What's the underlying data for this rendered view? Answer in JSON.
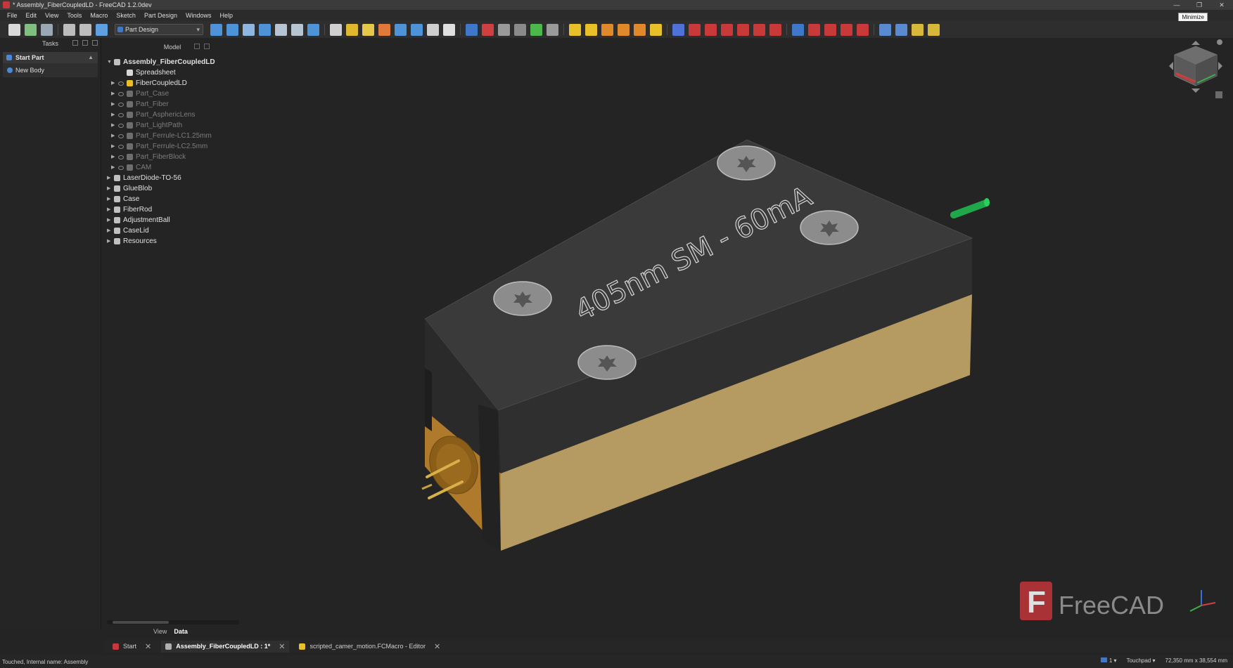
{
  "window": {
    "title": "* Assembly_FiberCoupledLD - FreeCAD 1.2.0dev",
    "minimize": "—",
    "restore": "❐",
    "close": "✕",
    "tooltip": "Minimize"
  },
  "menu": [
    "File",
    "Edit",
    "View",
    "Tools",
    "Macro",
    "Sketch",
    "Part Design",
    "Windows",
    "Help"
  ],
  "toolbar": {
    "workbench": "Part Design"
  },
  "tasks": {
    "header": "Tasks",
    "box_title": "Start Part",
    "items": [
      "New Body"
    ]
  },
  "model": {
    "header": "Model",
    "tree": [
      {
        "label": "Assembly_FiberCoupledLD",
        "level": 0
      },
      {
        "label": "Spreadsheet",
        "level": 1
      },
      {
        "label": "FiberCoupledLD",
        "level": 1
      },
      {
        "label": "Part_Case",
        "level": 1
      },
      {
        "label": "Part_Fiber",
        "level": 1
      },
      {
        "label": "Part_AsphericLens",
        "level": 1
      },
      {
        "label": "Part_LightPath",
        "level": 1
      },
      {
        "label": "Part_Ferrule-LC1.25mm",
        "level": 1
      },
      {
        "label": "Part_Ferrule-LC2.5mm",
        "level": 1
      },
      {
        "label": "Part_FiberBlock",
        "level": 1
      },
      {
        "label": "CAM",
        "level": 1
      },
      {
        "label": "LaserDiode-TO-56",
        "level": 0
      },
      {
        "label": "GlueBlob",
        "level": 0
      },
      {
        "label": "Case",
        "level": 0
      },
      {
        "label": "FiberRod",
        "level": 0
      },
      {
        "label": "AdjustmentBall",
        "level": 0
      },
      {
        "label": "CaseLid",
        "level": 0
      },
      {
        "label": "Resources",
        "level": 0
      }
    ],
    "tabs": [
      "View",
      "Data"
    ]
  },
  "viewport": {
    "engraving": "405nm SM - 60mA",
    "watermark": "FreeCAD",
    "colors": {
      "lid": "#363636",
      "brass": "#c9a86a",
      "fiber": "#1fa84a",
      "screw": "#8c8c8c"
    }
  },
  "doc_tabs": [
    {
      "label": "Start",
      "active": false
    },
    {
      "label": "Assembly_FiberCoupledLD : 1*",
      "active": true
    },
    {
      "label": "scripted_camer_motion.FCMacro - Editor",
      "active": false
    }
  ],
  "status": {
    "text": "Touched, Internal name: Assembly",
    "page": "1",
    "navigation": "Touchpad",
    "dimensions": "72,350 mm x 38,554 mm"
  }
}
